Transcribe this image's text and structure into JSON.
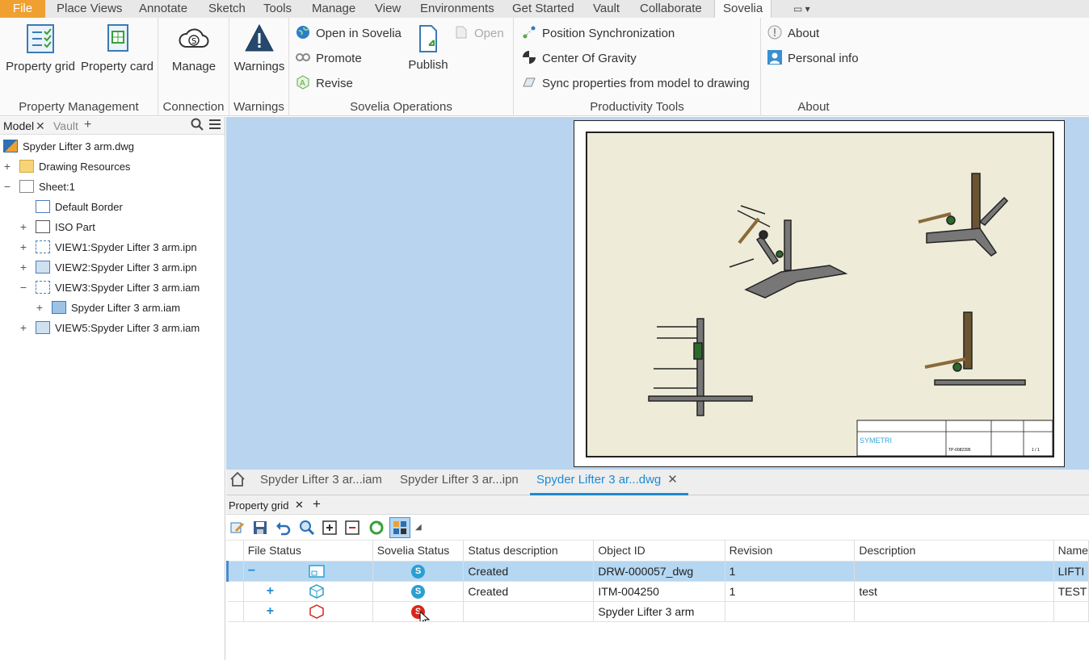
{
  "menu": {
    "file": "File",
    "items": [
      "Place Views",
      "Annotate",
      "Sketch",
      "Tools",
      "Manage",
      "View",
      "Environments",
      "Get Started",
      "Vault",
      "Collaborate",
      "Sovelia"
    ]
  },
  "ribbon": {
    "property_grid": "Property grid",
    "property_card": "Property card",
    "property_management": "Property Management",
    "manage": "Manage",
    "connection": "Connection",
    "warnings": "Warnings",
    "warnings_group": "Warnings",
    "open_in_sovelia": "Open in Sovelia",
    "promote": "Promote",
    "revise": "Revise",
    "publish": "Publish",
    "open": "Open",
    "sovelia_operations": "Sovelia Operations",
    "position_sync": "Position Synchronization",
    "center_of_gravity": "Center Of Gravity",
    "sync_props": "Sync properties from model to drawing",
    "productivity_tools": "Productivity Tools",
    "about": "About",
    "personal_info": "Personal info",
    "about_group": "About"
  },
  "browser": {
    "tab_model": "Model",
    "tab_vault": "Vault",
    "nodes": [
      "Spyder Lifter 3 arm.dwg",
      "Drawing Resources",
      "Sheet:1",
      "Default Border",
      "ISO Part",
      "VIEW1:Spyder Lifter 3 arm.ipn",
      "VIEW2:Spyder Lifter 3 arm.ipn",
      "VIEW3:Spyder Lifter 3 arm.iam",
      "Spyder Lifter 3 arm.iam",
      "VIEW5:Spyder Lifter 3 arm.iam"
    ]
  },
  "titleblock": {
    "company": "SYMETRI",
    "doc": "TP-0082395",
    "sheet": "1 / 1"
  },
  "doctabs": [
    "Spyder Lifter 3 ar...iam",
    "Spyder Lifter 3 ar...ipn",
    "Spyder Lifter 3 ar...dwg"
  ],
  "propgrid": {
    "tab": "Property grid",
    "columns": [
      "File Status",
      "Sovelia Status",
      "Status description",
      "Object ID",
      "Revision",
      "Description",
      "Name"
    ],
    "rows": [
      {
        "desc": "Created",
        "id": "DRW-000057_dwg",
        "rev": "1",
        "description": "",
        "name": "LIFTI"
      },
      {
        "desc": "Created",
        "id": "ITM-004250",
        "rev": "1",
        "description": "test",
        "name": "TEST"
      },
      {
        "desc": "",
        "id": "Spyder Lifter 3 arm",
        "rev": "",
        "description": "",
        "name": ""
      }
    ],
    "status_letter": "S",
    "colors": {
      "blue": "#2b9fd1",
      "red": "#d9261c"
    }
  }
}
